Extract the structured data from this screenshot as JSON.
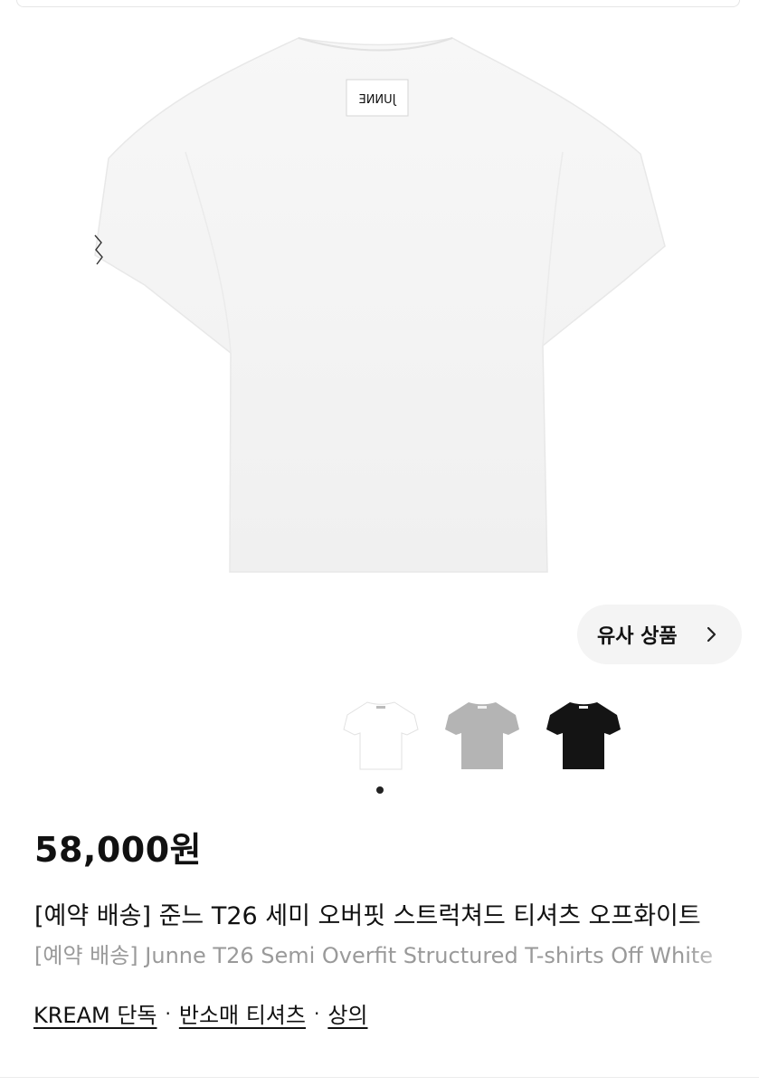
{
  "product": {
    "image_label": "JUNNE",
    "similar_button_label": "유사 상품",
    "colors": [
      "#ffffff",
      "#b4b4b4",
      "#141414"
    ],
    "thumbnails_count": 3,
    "active_page": 1,
    "price": "58,000원",
    "title_ko": "[예약 배송] 준느 T26 세미 오버핏 스트럭쳐드 티셔츠 오프화이트",
    "title_en": "[예약 배송] Junne T26 Semi Overfit Structured T-shirts Off White",
    "tags": [
      "KREAM 단독",
      "반소매 티셔츠",
      "상의"
    ],
    "tag_separator": "·"
  }
}
